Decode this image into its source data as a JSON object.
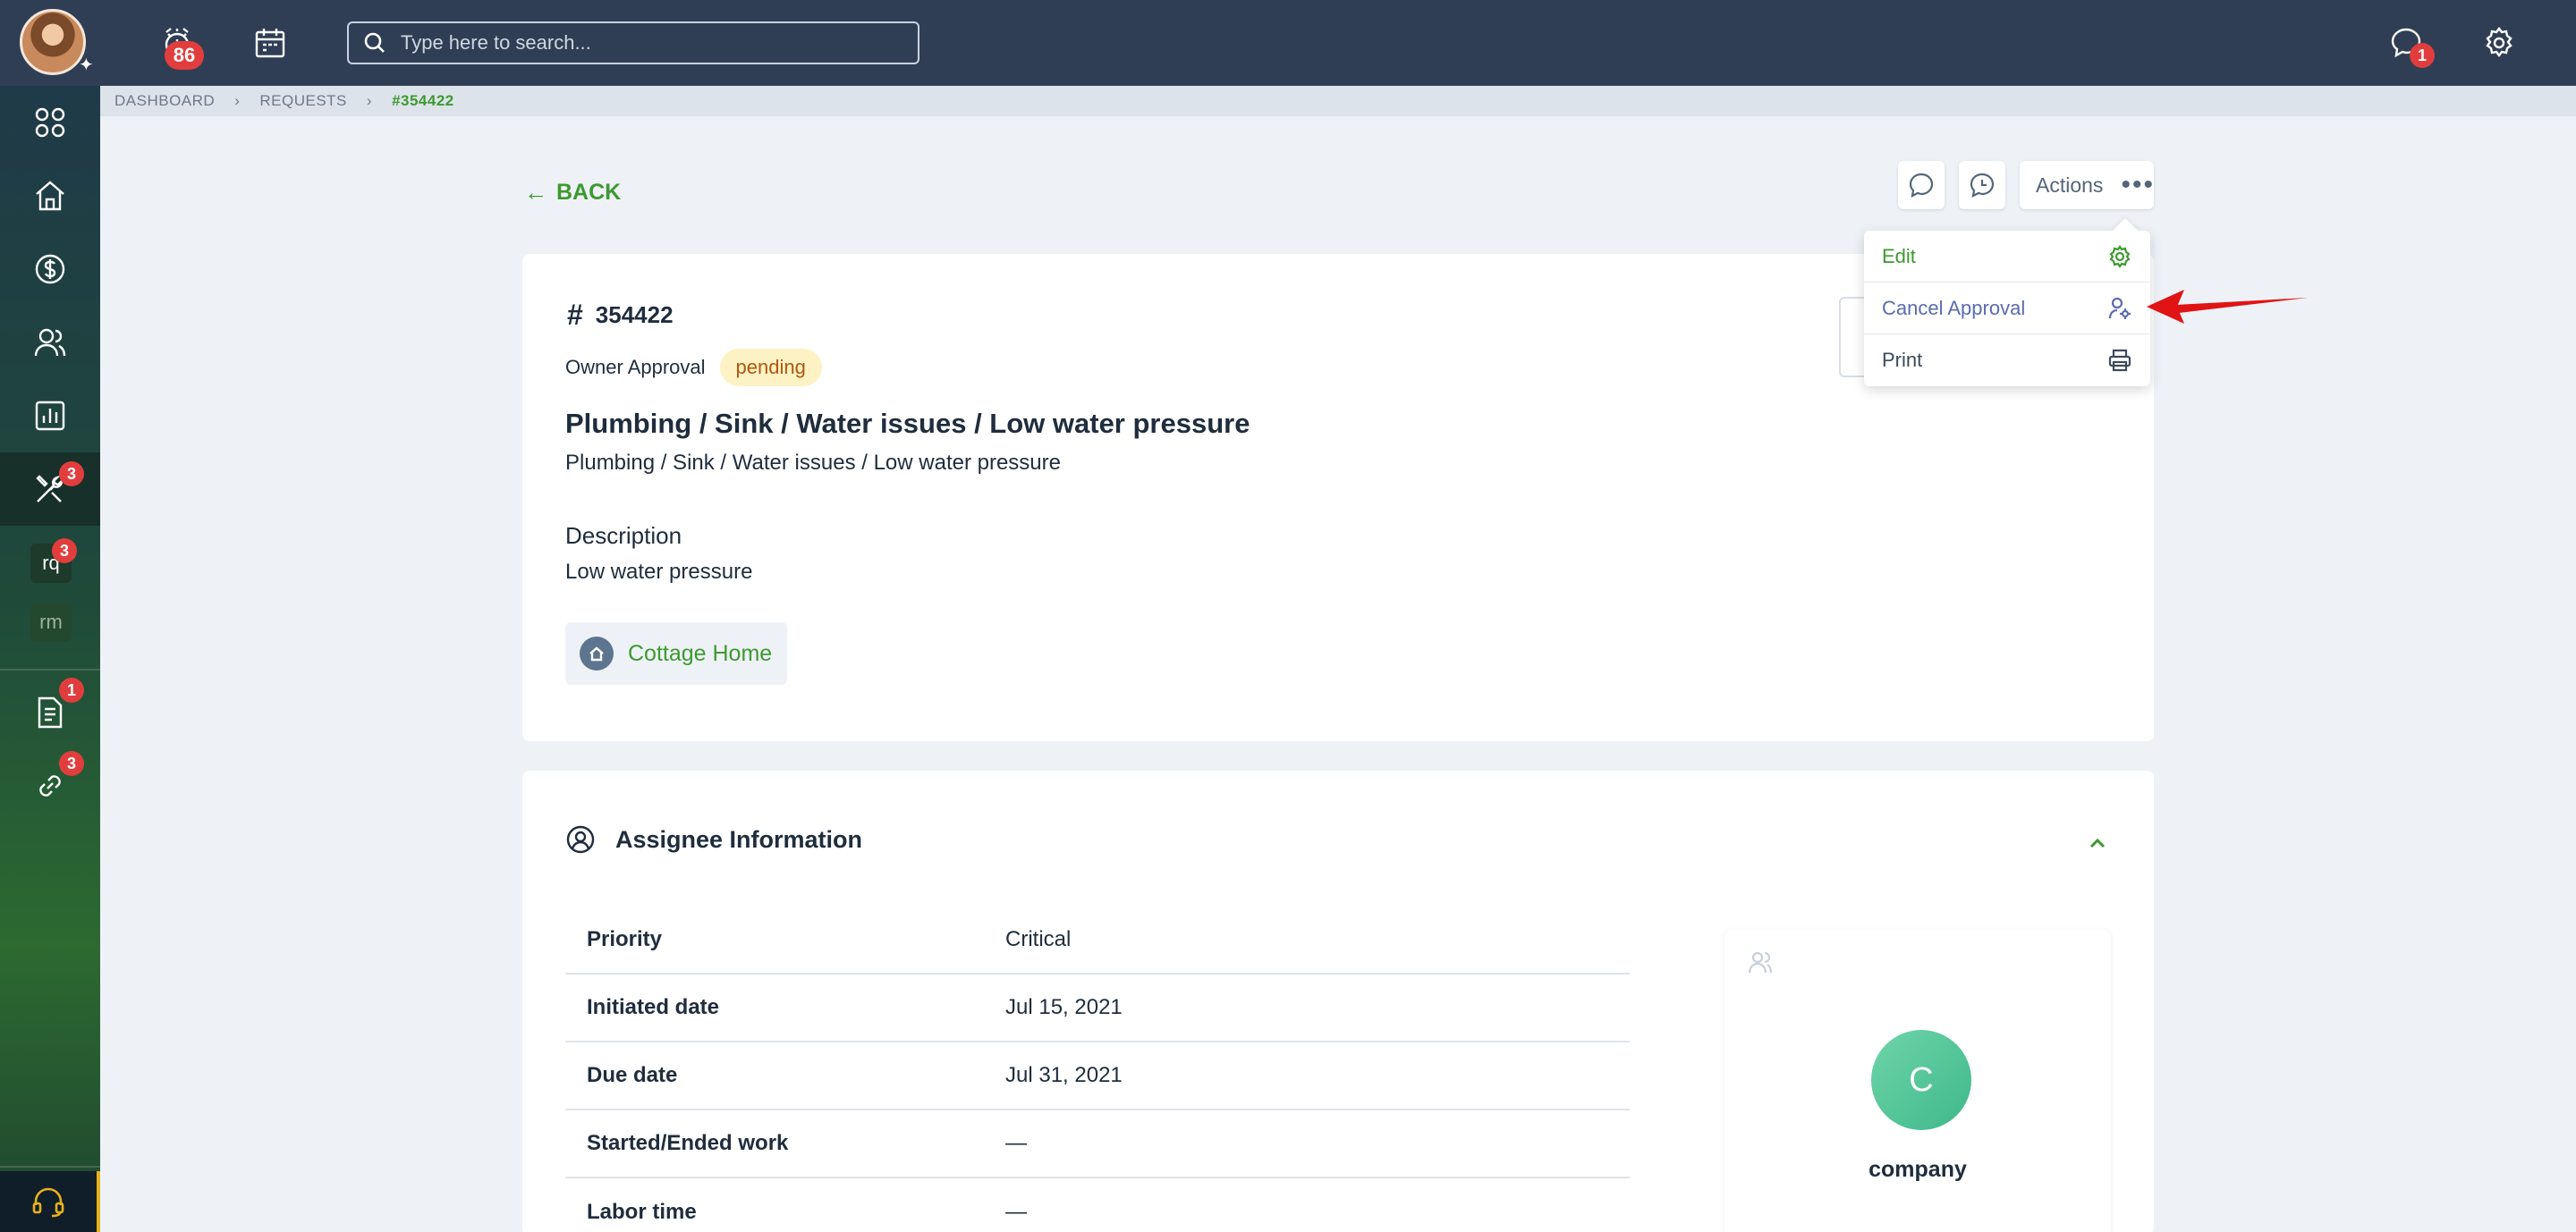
{
  "topbar": {
    "notifications_count": "86",
    "messages_count": "1",
    "search_placeholder": "Type here to search..."
  },
  "sidebar": {
    "maintenance_badge": "3",
    "rq_label": "rq",
    "rq_badge": "3",
    "rm_label": "rm",
    "documents_badge": "1",
    "links_badge": "3"
  },
  "breadcrumb": {
    "items": [
      "DASHBOARD",
      "REQUESTS",
      "#354422"
    ]
  },
  "back_label": "BACK",
  "actions": {
    "label": "Actions",
    "menu": [
      {
        "label": "Edit",
        "icon": "gear-icon"
      },
      {
        "label": "Cancel Approval",
        "icon": "user-gear-icon"
      },
      {
        "label": "Print",
        "icon": "printer-icon"
      }
    ]
  },
  "request": {
    "id": "354422",
    "approval_label": "Owner Approval",
    "approval_status": "pending",
    "category_title": "Plumbing / Sink / Water issues / Low water pressure",
    "category_subtitle": "Plumbing / Sink / Water issues / Low water pressure",
    "description_label": "Description",
    "description": "Low water pressure",
    "property": "Cottage Home"
  },
  "assignee": {
    "heading": "Assignee Information",
    "rows": [
      {
        "key": "Priority",
        "value": "Critical"
      },
      {
        "key": "Initiated date",
        "value": "Jul 15, 2021"
      },
      {
        "key": "Due date",
        "value": "Jul 31, 2021"
      },
      {
        "key": "Started/Ended work",
        "value": "—"
      },
      {
        "key": "Labor time",
        "value": "—"
      }
    ],
    "company_initial": "C",
    "company_name": "company"
  },
  "colors": {
    "topbar": "#2f3e55",
    "accent_green": "#3c9a2e",
    "badge_red": "#e23d3d",
    "cancel_purple": "#5a6bb0",
    "pending_bg": "#fdf2c4"
  }
}
